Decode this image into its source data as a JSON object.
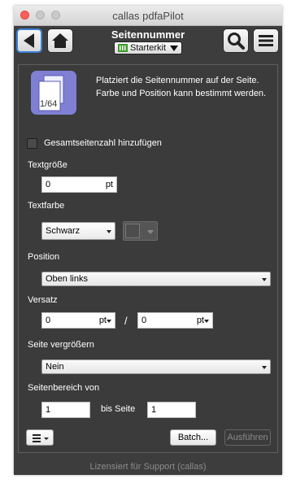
{
  "window": {
    "title": "callas pdfaPilot"
  },
  "toolbar": {
    "title": "Seitennummer",
    "kit_label": "Starterkit",
    "icons": {
      "back": "arrow-left-icon",
      "home": "home-icon",
      "search": "magnifier-icon",
      "menu": "hamburger-menu-icon"
    }
  },
  "header": {
    "thumbnail_text": "1/64",
    "description": "Platziert die Seitennummer auf der Seite. Farbe und Position kann bestimmt werden."
  },
  "form": {
    "total_pages_label": "Gesamtseitenzahl hinzufügen",
    "total_pages_checked": false,
    "font_size_label": "Textgröße",
    "font_size_value": "0",
    "font_size_unit": "pt",
    "text_color_label": "Textfarbe",
    "text_color_value": "Schwarz",
    "position_label": "Position",
    "position_value": "Oben links",
    "offset_label": "Versatz",
    "offset_x_value": "0",
    "offset_x_unit": "pt",
    "offset_separator": "/",
    "offset_y_value": "0",
    "offset_y_unit": "pt",
    "enlarge_label": "Seite vergrößern",
    "enlarge_value": "Nein",
    "range_label": "Seitenbereich von",
    "range_from": "1",
    "range_to_label": "bis Seite",
    "range_to": "1"
  },
  "footer": {
    "batch_label": "Batch...",
    "run_label": "Ausführen",
    "license": "Lizensiert für Support (callas)"
  },
  "colors": {
    "background": "#3d3d3d",
    "thumbnail": "#7f7fd3",
    "accent_blue": "#3b82d6",
    "kit_green": "#3e9a29"
  }
}
